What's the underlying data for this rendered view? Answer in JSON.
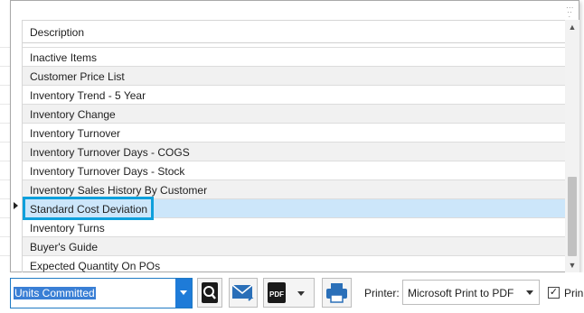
{
  "dropdown": {
    "column_header": "Description",
    "rows": [
      "Inactive Items",
      "Customer Price List",
      "Inventory Trend - 5 Year",
      "Inventory Change",
      "Inventory Turnover",
      "Inventory Turnover Days - COGS",
      "Inventory Turnover Days - Stock",
      "Inventory Sales History By Customer",
      "Standard Cost Deviation",
      "Inventory Turns",
      "Buyer's Guide",
      "Expected Quantity On POs"
    ],
    "selected_row": "Standard Cost Deviation",
    "scrollbar": {
      "up_arrow": "▲",
      "down_arrow": "▼"
    }
  },
  "toolbar": {
    "report_combo_value": "Units Committed",
    "preview_icon": "magnifier-document-icon",
    "email_icon": "envelope-icon",
    "pdf_icon": "pdf-icon",
    "pdf_text": "PDF",
    "print_icon": "printer-icon",
    "printer_label": "Printer:",
    "printer_value": "Microsoft Print to PDF",
    "checkbox_checked": true,
    "checkbox_label": "Prin"
  },
  "colors": {
    "selection": "#cce6fa",
    "focus_border": "#0ea0dc",
    "accent": "#1e7bd8"
  }
}
